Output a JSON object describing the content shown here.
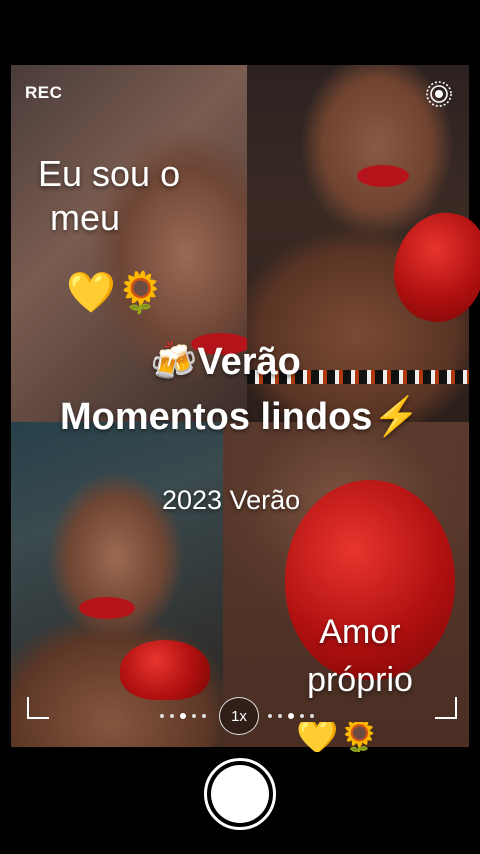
{
  "status": {
    "rec_label": "REC"
  },
  "icons": {
    "live": "live-target-icon",
    "shutter": "shutter-button"
  },
  "overlay": {
    "caption_line1": "Eu sou o",
    "caption_line2": "meu",
    "caption_emojis": "💛🌻",
    "title_line1": "🍻Verão",
    "title_line2": "Momentos lindos⚡",
    "year_text": "2023 Verão",
    "amor_line1": "Amor",
    "amor_line2": "próprio",
    "bottom_emojis": "💛🌻"
  },
  "camera": {
    "zoom_label": "1x"
  },
  "colors": {
    "accent_red": "#b01010",
    "background": "#000000"
  }
}
